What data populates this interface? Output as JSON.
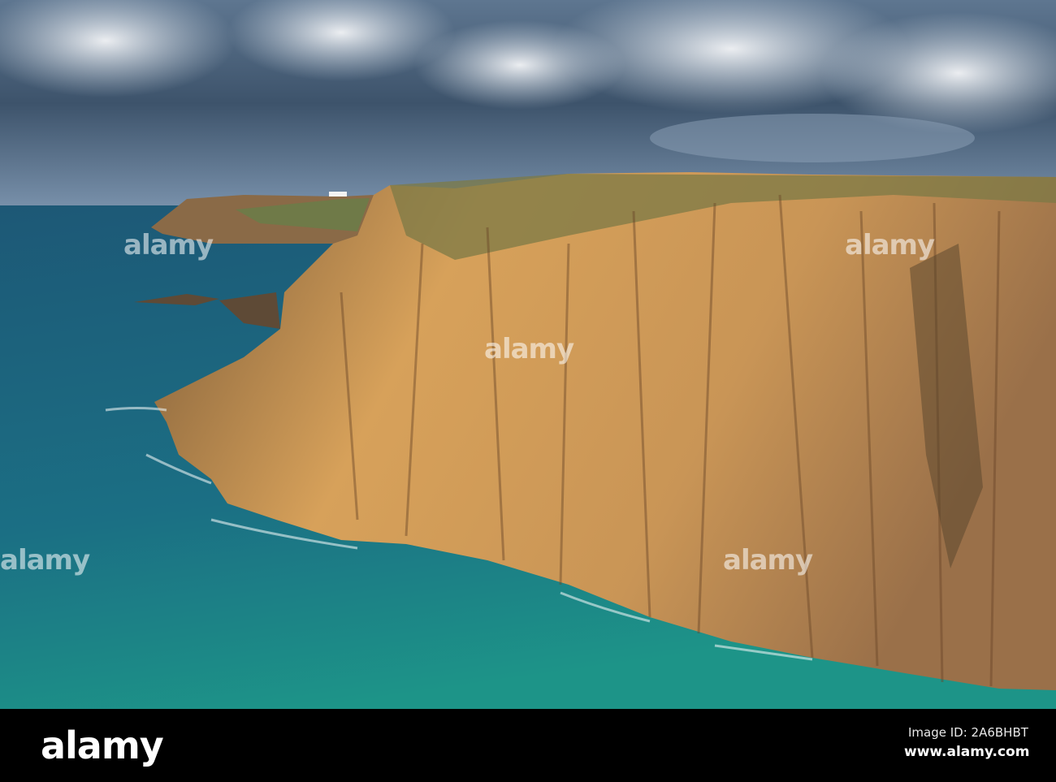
{
  "photo": {
    "watermark_text": "alamy",
    "colors": {
      "sky_top": "#3f5670",
      "sky_bottom": "#6d88a4",
      "sea_far": "#1d5f7c",
      "sea_near": "#1c8f8a",
      "cliff_light": "#d9a55c",
      "cliff_dark": "#6d4a2c",
      "grass": "#7a7a45"
    }
  },
  "footer": {
    "logo": "alamy",
    "image_id": "Image ID: 2A6BHBT",
    "url": "www.alamy.com"
  }
}
